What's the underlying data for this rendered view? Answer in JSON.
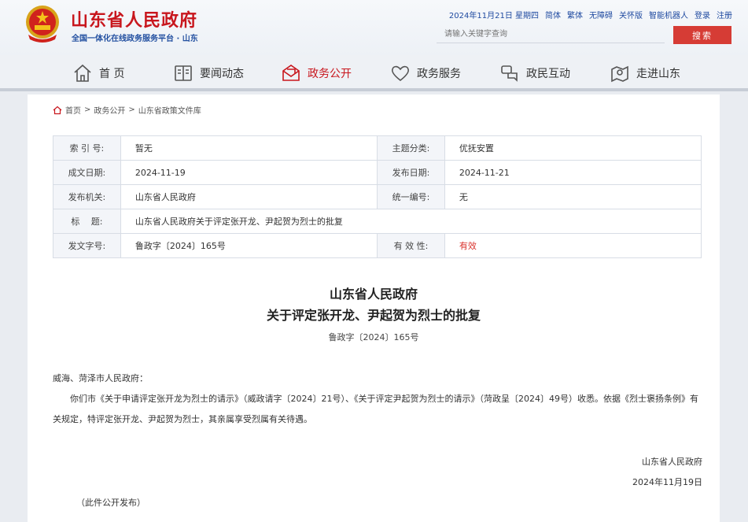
{
  "header": {
    "site_title": "山东省人民政府",
    "site_subtitle": "全国一体化在线政务服务平台 · 山东",
    "date_text": "2024年11月21日 星期四",
    "top_links": [
      "简体",
      "繁体",
      "无障碍",
      "关怀版",
      "智能机器人",
      "登录",
      "注册"
    ],
    "search_placeholder": "请输入关键字查询",
    "search_button": "搜索"
  },
  "nav": {
    "items": [
      {
        "label": "首 页",
        "icon": "home-icon"
      },
      {
        "label": "要闻动态",
        "icon": "book-icon"
      },
      {
        "label": "政务公开",
        "icon": "envelope-icon"
      },
      {
        "label": "政务服务",
        "icon": "heart-icon"
      },
      {
        "label": "政民互动",
        "icon": "chat-icon"
      },
      {
        "label": "走进山东",
        "icon": "map-pin-icon"
      }
    ],
    "active_index": 2,
    "active_color": "#c8161d"
  },
  "breadcrumb": [
    "首页",
    "政务公开",
    "山东省政策文件库"
  ],
  "meta": {
    "index_label": "索 引 号:",
    "index_value": "暂无",
    "topic_label": "主题分类:",
    "topic_value": "优抚安置",
    "created_label": "成文日期:",
    "created_value": "2024-11-19",
    "published_label": "发布日期:",
    "published_value": "2024-11-21",
    "issuer_label": "发布机关:",
    "issuer_value": "山东省人民政府",
    "unified_label": "统一编号:",
    "unified_value": "无",
    "title_label": "标　 题:",
    "title_value": "山东省人民政府关于评定张开龙、尹起贺为烈士的批复",
    "docno_label": "发文字号:",
    "docno_value": "鲁政字〔2024〕165号",
    "validity_label": "有 效 性:",
    "validity_value": "有效"
  },
  "document": {
    "issuer": "山东省人民政府",
    "title": "关于评定张开龙、尹起贺为烈士的批复",
    "number": "鲁政字〔2024〕165号",
    "addressee": "威海、菏泽市人民政府：",
    "paragraph": "你们市《关于申请评定张开龙为烈士的请示》（威政请字〔2024〕21号）、《关于评定尹起贺为烈士的请示》（菏政呈〔2024〕49号）收悉。依据《烈士褒扬条例》有关规定，特评定张开龙、尹起贺为烈士，其亲属享受烈属有关待遇。",
    "sign_org": "山东省人民政府",
    "sign_date": "2024年11月19日",
    "note": "（此件公开发布）"
  }
}
